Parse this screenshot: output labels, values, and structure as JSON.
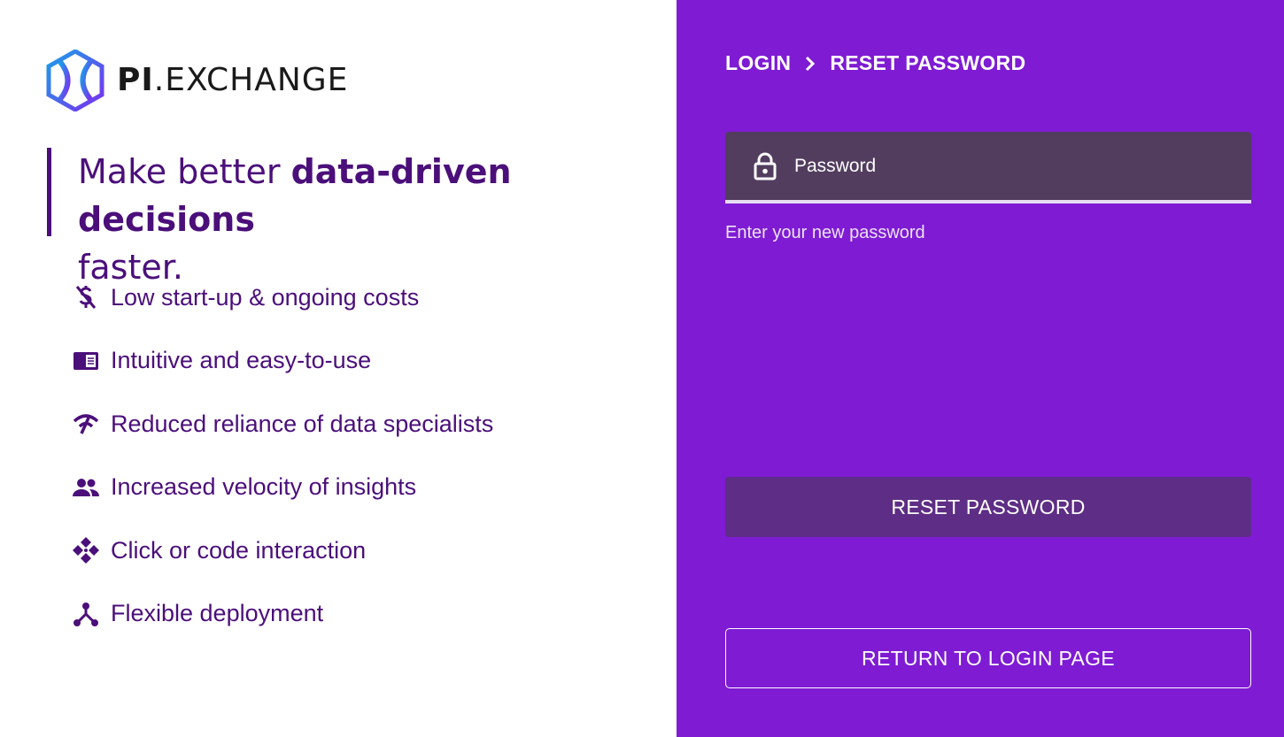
{
  "brand": {
    "logo_icon": "hexagon-x-logo-icon",
    "name_bold": "PI",
    "name_rest": ".EXCHANGE"
  },
  "tagline": {
    "prefix": "Make better ",
    "highlight": "data-driven decisions",
    "suffix": "faster."
  },
  "features": [
    {
      "icon": "no-money-icon",
      "label": "Low start-up & ongoing costs"
    },
    {
      "icon": "book-icon",
      "label": "Intuitive and easy-to-use"
    },
    {
      "icon": "signal-off-icon",
      "label": "Reduced reliance of data specialists"
    },
    {
      "icon": "people-icon",
      "label": "Increased velocity of insights"
    },
    {
      "icon": "diamond-nodes-icon",
      "label": "Click or code interaction"
    },
    {
      "icon": "branch-nodes-icon",
      "label": "Flexible deployment"
    }
  ],
  "breadcrumb": {
    "first": "LOGIN",
    "separator_icon": "chevron-right-icon",
    "current": "RESET PASSWORD"
  },
  "password_field": {
    "icon": "lock-icon",
    "placeholder": "Password",
    "value": "",
    "helper": "Enter your new password"
  },
  "actions": {
    "reset_label": "RESET PASSWORD",
    "return_label": "RETURN TO LOGIN PAGE"
  },
  "colors": {
    "panel": "#7e1bd3",
    "text_primary": "#4b0f7a",
    "field_bg": "#523d5f",
    "button_bg": "#5e2d85"
  }
}
